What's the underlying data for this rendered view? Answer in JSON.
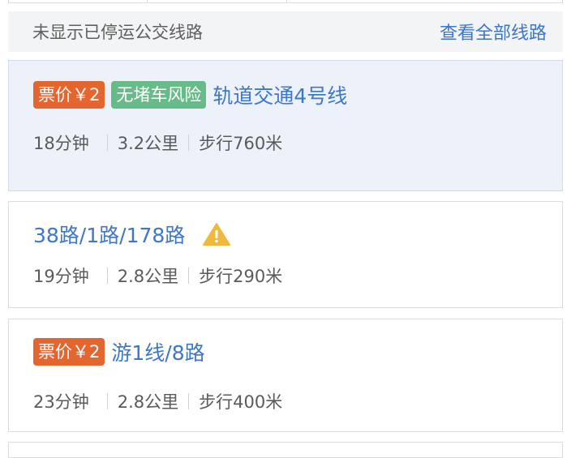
{
  "notice": {
    "message": "未显示已停运公交线路",
    "view_all_label": "查看全部线路"
  },
  "routes": [
    {
      "price_tag": "票价￥2",
      "risk_tag": "无堵车风险",
      "name": "轨道交通4号线",
      "duration": "18分钟",
      "distance": "3.2公里",
      "walk": "步行760米"
    },
    {
      "name": "38路/1路/178路",
      "warning_icon": "warning-icon",
      "duration": "19分钟",
      "distance": "2.8公里",
      "walk": "步行290米"
    },
    {
      "price_tag": "票价￥2",
      "name": "游1线/8路",
      "duration": "23分钟",
      "distance": "2.8公里",
      "walk": "步行400米"
    }
  ],
  "colors": {
    "link_blue": "#3e76c8",
    "price_orange": "#e5652f",
    "safe_green": "#67bb88",
    "selected_bg": "#edf1fa",
    "warning_yellow": "#f0b93b"
  }
}
